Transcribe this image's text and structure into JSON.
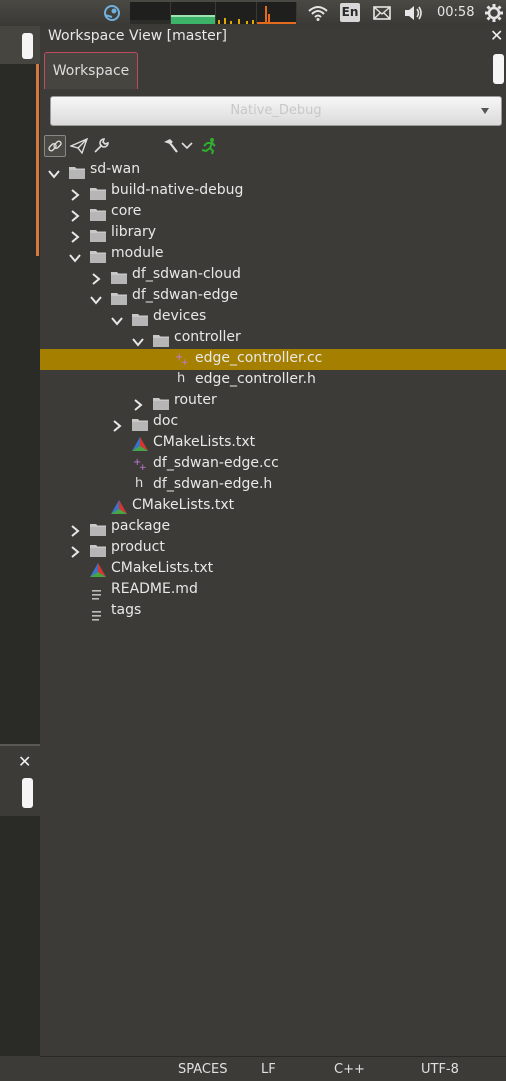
{
  "top_panel": {
    "keyboard_layout": "En",
    "clock": "00:58"
  },
  "workspace": {
    "title": "Workspace View [master]",
    "tab_label": "Workspace",
    "build_config": "Native_Debug"
  },
  "tree": [
    {
      "label": "sd-wan",
      "type": "folder",
      "depth": 0,
      "expanded": true
    },
    {
      "label": "build-native-debug",
      "type": "folder",
      "depth": 1,
      "expanded": false
    },
    {
      "label": "core",
      "type": "folder",
      "depth": 1,
      "expanded": false
    },
    {
      "label": "library",
      "type": "folder",
      "depth": 1,
      "expanded": false
    },
    {
      "label": "module",
      "type": "folder",
      "depth": 1,
      "expanded": true
    },
    {
      "label": "df_sdwan-cloud",
      "type": "folder",
      "depth": 2,
      "expanded": false
    },
    {
      "label": "df_sdwan-edge",
      "type": "folder",
      "depth": 2,
      "expanded": true
    },
    {
      "label": "devices",
      "type": "folder",
      "depth": 3,
      "expanded": true
    },
    {
      "label": "controller",
      "type": "folder",
      "depth": 4,
      "expanded": true
    },
    {
      "label": "edge_controller.cc",
      "type": "cc",
      "depth": 5,
      "selected": true
    },
    {
      "label": "edge_controller.h",
      "type": "h",
      "depth": 5
    },
    {
      "label": "router",
      "type": "folder",
      "depth": 4,
      "expanded": false
    },
    {
      "label": "doc",
      "type": "folder",
      "depth": 3,
      "expanded": false
    },
    {
      "label": "CMakeLists.txt",
      "type": "cmake",
      "depth": 3
    },
    {
      "label": "df_sdwan-edge.cc",
      "type": "cc",
      "depth": 3
    },
    {
      "label": "df_sdwan-edge.h",
      "type": "h",
      "depth": 3
    },
    {
      "label": "CMakeLists.txt",
      "type": "cmake",
      "depth": 2
    },
    {
      "label": "package",
      "type": "folder",
      "depth": 1,
      "expanded": false
    },
    {
      "label": "product",
      "type": "folder",
      "depth": 1,
      "expanded": false
    },
    {
      "label": "CMakeLists.txt",
      "type": "cmake",
      "depth": 1
    },
    {
      "label": "README.md",
      "type": "text",
      "depth": 1
    },
    {
      "label": "tags",
      "type": "text",
      "depth": 1
    }
  ],
  "status_bar": {
    "indent": "SPACES",
    "line_ending": "LF",
    "language": "C++",
    "encoding": "UTF-8"
  },
  "colors": {
    "selection": "#a58000",
    "accent_orange": "#d6793f",
    "tab_border": "#c24a5e",
    "run_icon": "#2fae2f"
  }
}
